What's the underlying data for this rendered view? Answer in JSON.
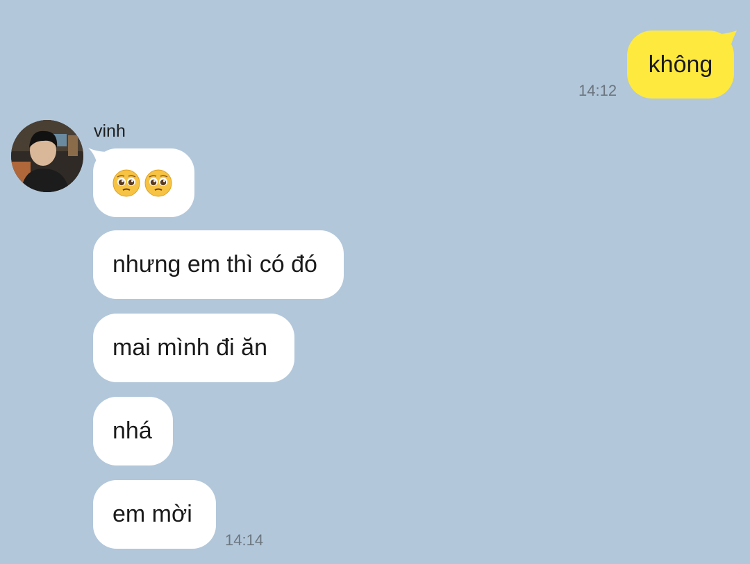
{
  "conversation": {
    "sent_message": {
      "text": "không",
      "time": "14:12",
      "bubble_color": "#fee93f"
    },
    "received": {
      "sender_name": "vinh",
      "avatar_icon": "user-avatar-photo",
      "messages": [
        {
          "emoji": [
            "pleading-face-icon",
            "pleading-face-icon"
          ],
          "text": "🥺🥺"
        },
        {
          "text": "nhưng em thì có đó"
        },
        {
          "text": "mai mình đi ăn"
        },
        {
          "text": "nhá"
        },
        {
          "text": "em mời"
        }
      ],
      "time": "14:14",
      "bubble_color": "#ffffff"
    },
    "background_color": "#b2c7da"
  }
}
